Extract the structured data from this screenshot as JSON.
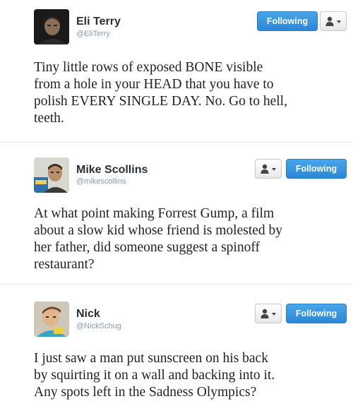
{
  "tweets": [
    {
      "display_name": "Eli Terry",
      "handle": "@EliTerry",
      "follow_label": "Following",
      "user_menu_icon": "user-dropdown-icon",
      "avatar": "profile-photo",
      "text_lines": [
        "Tiny little rows of exposed BONE visible",
        "from a hole in your HEAD that you have to",
        "polish EVERY SINGLE DAY. No. Go to hell,",
        "teeth."
      ]
    },
    {
      "display_name": "Mike Scollins",
      "handle": "@mikescollins",
      "follow_label": "Following",
      "user_menu_icon": "user-dropdown-icon",
      "avatar": "profile-photo",
      "text_lines": [
        "At what point making Forrest Gump, a film",
        "about a slow kid whose friend is molested by",
        "her father, did someone suggest a spinoff",
        "restaurant?"
      ]
    },
    {
      "display_name": "Nick",
      "handle": "@NickSchug",
      "follow_label": "Following",
      "user_menu_icon": "user-dropdown-icon",
      "avatar": "profile-photo",
      "text_lines": [
        "I just saw a man put sunscreen on his back",
        "by squirting it on a wall and backing into it.",
        "Any spots left in the Sadness Olympics?"
      ]
    }
  ],
  "colors": {
    "follow_button": "#2b87d6",
    "handle": "#8899a6",
    "name": "#292f33"
  }
}
